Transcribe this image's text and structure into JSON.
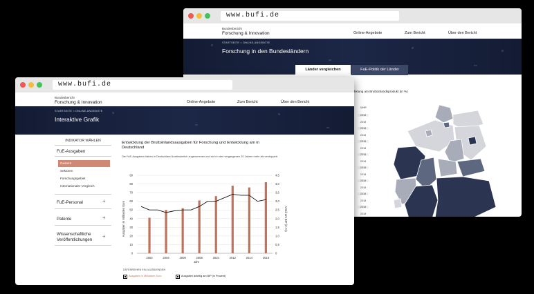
{
  "browser": {
    "url": "www.bufi.de",
    "dot_colors": [
      "#ee5a52",
      "#f4be3a",
      "#46c25a"
    ]
  },
  "site": {
    "brand_small": "Bundesbericht",
    "brand_big": "Forschung & Innovation",
    "nav": [
      "Online-Angebote",
      "Zum Bericht",
      "Über den Bericht"
    ]
  },
  "back_page": {
    "breadcrumb": "STARTSEITE  >  ONLINE-ANGEBOTE",
    "title": "Forschung in den Bundesländern",
    "tabs": [
      "Länder vergleichen",
      "FuE-Politik der Länder"
    ],
    "active_tab": 0,
    "chart_text": "ikklung am Bruttoinlandsprodukt (in %)",
    "year_header": "JAHR",
    "years": [
      "2018",
      "2018",
      "2018",
      "2018",
      "2018",
      "2018",
      "2018",
      "2018",
      "2018",
      "2018",
      "2018",
      "2018",
      "2018",
      "2018",
      "2018",
      "2018"
    ],
    "map_colors": {
      "dark": "#2b3552",
      "mid": "#5d6780",
      "light": "#a7acb8",
      "pale": "#d4d6dc"
    }
  },
  "front_page": {
    "breadcrumb": "STARTSEITE  >  ONLINE-ANGEBOTE",
    "title": "Interaktive Grafik",
    "sidebar": {
      "header": "INDIKATOR WÄHLEN",
      "section_main": "FuE-Ausgaben",
      "subitems": [
        "Gesamt",
        "Sektoren",
        "Forschungsgebiet",
        "Internationaler Vergleich"
      ],
      "active_subitem": 0,
      "sections": [
        "FuE-Personal",
        "Patente",
        "Wissenschaftliche Veröffentlichungen"
      ]
    },
    "chart_title": "Entwicklung der Bruttoinlandsausgaben für Forschung und Entwicklung am in Deutschland",
    "chart_desc": "Die FuE-Ausgaben haben in Deutschland kontinuierlich zugenommen und sich in den vergangenen 20 Jahren mehr als verdoppelt.",
    "legend_title": "DATENREIHEN EIN-/AUSBLENDEN",
    "legend_items": [
      "Ausgaben in Milliarden Euro",
      "Ausgaben anteilig am BIP (in Prozent)"
    ]
  },
  "chart_data": {
    "type": "bar",
    "xlabel": "Jahr",
    "ylabel": "Ausgaben in Milliarden Euro",
    "y2label": "Anteil am BIP (in %)",
    "ylim": [
      0,
      90
    ],
    "y2lim": [
      0,
      4.5
    ],
    "yticks": [
      0,
      10,
      20,
      30,
      40,
      50,
      60,
      70,
      80,
      90
    ],
    "y2ticks": [
      "0",
      "0,5",
      "1,0",
      "1,5",
      "2,0",
      "2,5",
      "3,0",
      "3,5",
      "4,0",
      "4,5"
    ],
    "xticks": [
      2002,
      2004,
      2006,
      2008,
      2010,
      2012,
      2014,
      2016
    ],
    "bars": {
      "name": "Ausgaben in Milliarden Euro",
      "color": "#c0735a",
      "x": [
        2002,
        2004,
        2006,
        2008,
        2010,
        2012,
        2014,
        2016
      ],
      "values": [
        41,
        50,
        52,
        61,
        66,
        78,
        76,
        82
      ]
    },
    "line": {
      "name": "Ausgaben anteilig am BIP (in Prozent)",
      "color": "#111111",
      "x": [
        2001,
        2002,
        2003,
        2004,
        2005,
        2006,
        2007,
        2008,
        2009,
        2010,
        2011,
        2012,
        2013,
        2014,
        2015,
        2016
      ],
      "values": [
        2.7,
        2.5,
        2.5,
        2.35,
        2.45,
        2.5,
        2.5,
        2.7,
        3.0,
        3.0,
        3.2,
        3.4,
        3.35,
        3.35,
        3.0,
        3.1
      ]
    }
  }
}
